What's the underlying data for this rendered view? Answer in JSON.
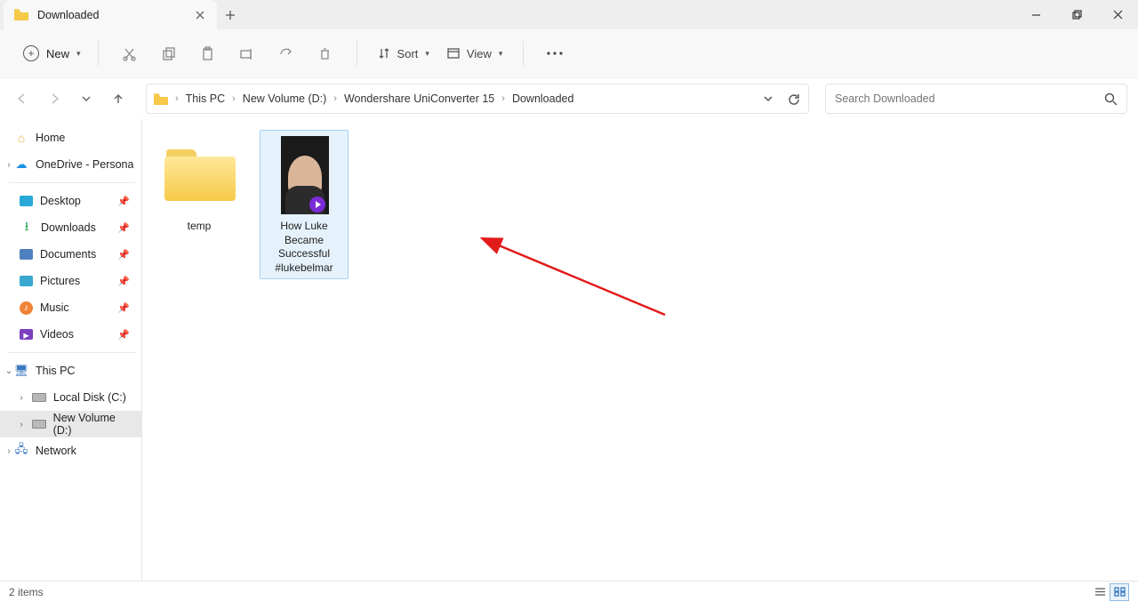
{
  "window": {
    "tab_title": "Downloaded"
  },
  "toolbar": {
    "new_label": "New",
    "sort_label": "Sort",
    "view_label": "View"
  },
  "breadcrumb": {
    "items": [
      "This PC",
      "New Volume (D:)",
      "Wondershare UniConverter 15",
      "Downloaded"
    ]
  },
  "search": {
    "placeholder": "Search Downloaded"
  },
  "sidebar": {
    "home": "Home",
    "onedrive": "OneDrive - Persona",
    "quick": [
      {
        "label": "Desktop"
      },
      {
        "label": "Downloads"
      },
      {
        "label": "Documents"
      },
      {
        "label": "Pictures"
      },
      {
        "label": "Music"
      },
      {
        "label": "Videos"
      }
    ],
    "this_pc": "This PC",
    "drives": [
      {
        "label": "Local Disk (C:)"
      },
      {
        "label": "New Volume (D:)"
      }
    ],
    "network": "Network"
  },
  "content": {
    "items": [
      {
        "type": "folder",
        "name": "temp"
      },
      {
        "type": "video",
        "name": "How Luke Became Successful #lukebelmar"
      }
    ]
  },
  "status": {
    "text": "2 items"
  }
}
